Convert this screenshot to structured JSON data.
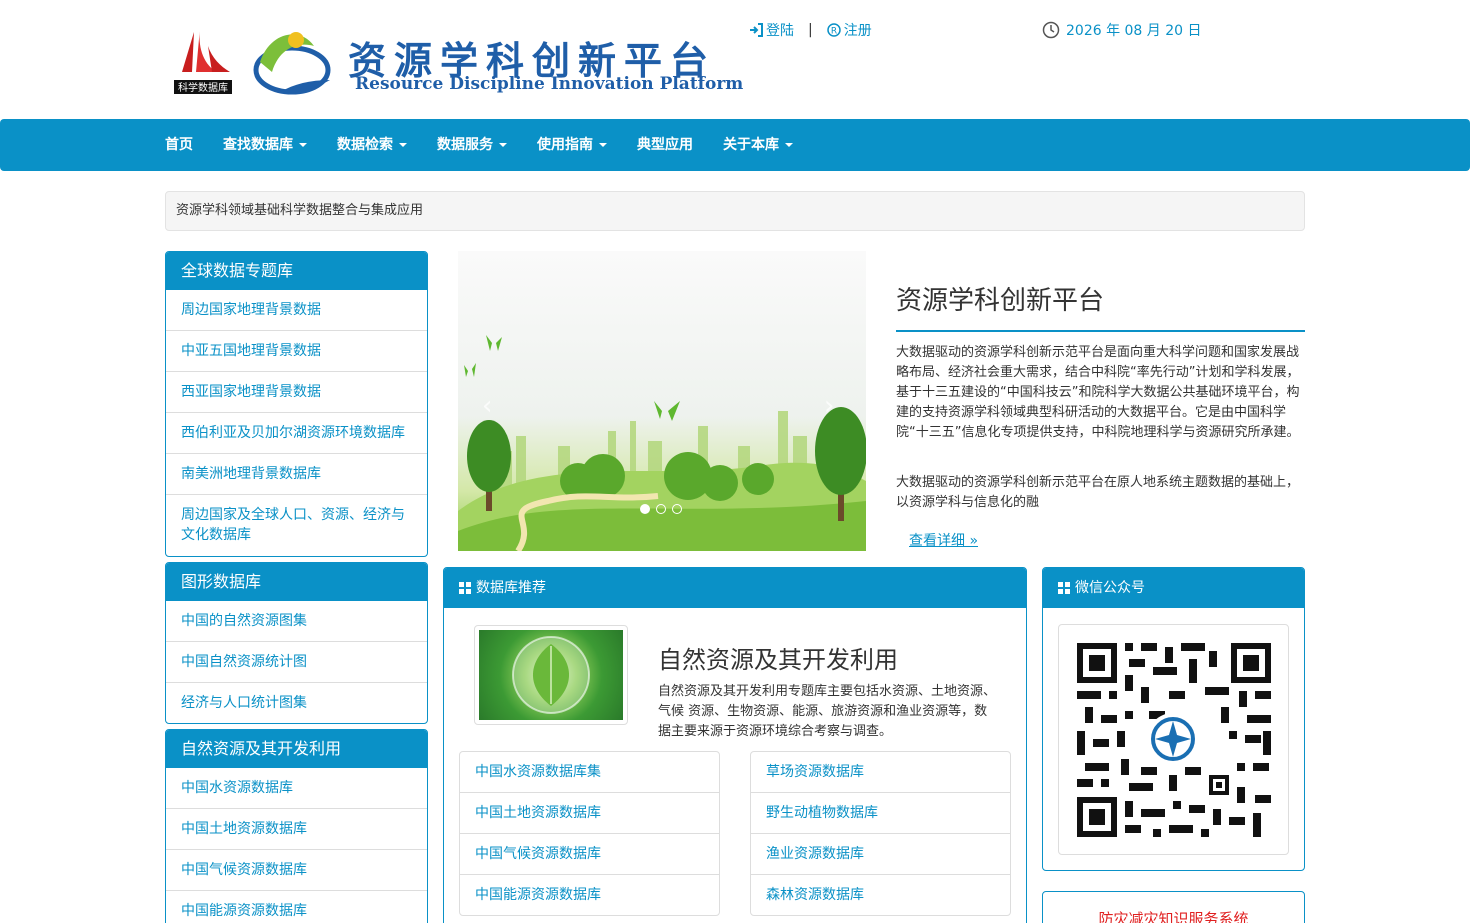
{
  "header": {
    "logo_badge": "科学数据库",
    "brand_cn": "资源学科创新平台",
    "brand_en": "Resource Discipline Innovation Platform",
    "login": "登陆",
    "separator": "|",
    "register": "注册",
    "date": "2026 年 08 月 20 日"
  },
  "nav": {
    "items": [
      {
        "label": "首页",
        "dropdown": false
      },
      {
        "label": "查找数据库",
        "dropdown": true
      },
      {
        "label": "数据检索",
        "dropdown": true
      },
      {
        "label": "数据服务",
        "dropdown": true
      },
      {
        "label": "使用指南",
        "dropdown": true
      },
      {
        "label": "典型应用",
        "dropdown": false
      },
      {
        "label": "关于本库",
        "dropdown": true
      }
    ]
  },
  "breadcrumb": "资源学科领域基础科学数据整合与集成应用",
  "sidebar": {
    "global": {
      "title": "全球数据专题库",
      "items": [
        "周边国家地理背景数据",
        "中亚五国地理背景数据",
        "西亚国家地理背景数据",
        "西伯利亚及贝加尔湖资源环境数据库",
        "南美洲地理背景数据库",
        "周边国家及全球人口、资源、经济与文化数据库"
      ]
    },
    "graphic": {
      "title": "图形数据库",
      "items": [
        "中国的自然资源图集",
        "中国自然资源统计图",
        "经济与人口统计图集"
      ]
    },
    "natural": {
      "title": "自然资源及其开发利用",
      "items": [
        "中国水资源数据库",
        "中国土地资源数据库",
        "中国气候资源数据库",
        "中国能源资源数据库"
      ]
    }
  },
  "carousel": {
    "prev": "‹",
    "next": "›",
    "active_index": 0,
    "slide_count": 3
  },
  "intro": {
    "title": "资源学科创新平台",
    "p1": "大数据驱动的资源学科创新示范平台是面向重大科学问题和国家发展战略布局、经济社会重大需求，结合中科院“率先行动”计划和学科发展，基于十三五建设的“中国科技云”和院科学大数据公共基础环境平台，构建的支持资源学科领域典型科研活动的大数据平台。它是由中国科学院“十三五”信息化专项提供支持，中科院地理科学与资源研究所承建。",
    "p2": "大数据驱动的资源学科创新示范平台在原人地系统主题数据的基础上，以资源学科与信息化的融",
    "more": "查看详细 »"
  },
  "recommend": {
    "title": "数据库推荐",
    "db_title": "自然资源及其开发利用",
    "db_desc": "自然资源及其开发利用专题库主要包括水资源、土地资源、气候 资源、生物资源、能源、旅游资源和渔业资源等，数据主要来源于资源环境综合考察与调查。",
    "left_list": [
      "中国水资源数据库集",
      "中国土地资源数据库",
      "中国气候资源数据库",
      "中国能源资源数据库"
    ],
    "right_list": [
      "草场资源数据库",
      "野生动植物数据库",
      "渔业资源数据库",
      "森林资源数据库"
    ]
  },
  "wechat": {
    "title": "微信公众号"
  },
  "disaster": {
    "label": "防灾减灾知识服务系统"
  },
  "colors": {
    "primary": "#0a91c7",
    "brand": "#1f5ea8",
    "alert": "#e02020"
  }
}
